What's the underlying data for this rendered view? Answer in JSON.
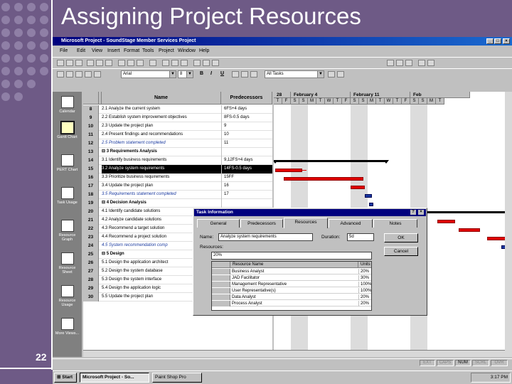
{
  "slide": {
    "title": "Assigning Project Resources",
    "number": "22"
  },
  "window": {
    "title": "Microsoft Project - SoundStage Member Services Project"
  },
  "menu": [
    "File",
    "Edit",
    "View",
    "Insert",
    "Format",
    "Tools",
    "Project",
    "Window",
    "Help"
  ],
  "toolbar": {
    "font": "Arial",
    "size": "8",
    "bold": "B",
    "italic": "I",
    "underline": "U",
    "filter": "All Tasks"
  },
  "views": [
    {
      "label": "Calendar",
      "icon": "calendar-icon"
    },
    {
      "label": "Gantt Chart",
      "icon": "gantt-chart-icon"
    },
    {
      "label": "PERT Chart",
      "icon": "pert-chart-icon"
    },
    {
      "label": "Task Usage",
      "icon": "task-usage-icon"
    },
    {
      "label": "Resource Graph",
      "icon": "resource-graph-icon"
    },
    {
      "label": "Resource Sheet",
      "icon": "resource-sheet-icon"
    },
    {
      "label": "Resource Usage",
      "icon": "resource-usage-icon"
    },
    {
      "label": "More Views...",
      "icon": "more-views-icon"
    }
  ],
  "table": {
    "headers": {
      "name": "Name",
      "predecessors": "Predecessors"
    },
    "rows": [
      {
        "id": "8",
        "name": "2.1 Analyze the current system",
        "pred": "6FS+4 days",
        "type": "task"
      },
      {
        "id": "9",
        "name": "2.2 Establish system improvement objectives",
        "pred": "8FS-0.5 days",
        "type": "task"
      },
      {
        "id": "10",
        "name": "2.3 Update the project plan",
        "pred": "9",
        "type": "task"
      },
      {
        "id": "11",
        "name": "2.4 Present findings and recommendations",
        "pred": "10",
        "type": "task"
      },
      {
        "id": "12",
        "name": "2.5 Problem statement completed",
        "pred": "11",
        "type": "milestone"
      },
      {
        "id": "13",
        "name": "⊟ 3 Requirements Analysis",
        "pred": "",
        "type": "summary"
      },
      {
        "id": "14",
        "name": "3.1 Identify business requirements",
        "pred": "9,12FS+4 days",
        "type": "task"
      },
      {
        "id": "15",
        "name": "3.2 Analyze system requirements",
        "pred": "14FS-0.5 days",
        "type": "selected"
      },
      {
        "id": "16",
        "name": "3.3 Prioritize business requirements",
        "pred": "15FF",
        "type": "task"
      },
      {
        "id": "17",
        "name": "3.4 Update the project plan",
        "pred": "16",
        "type": "task"
      },
      {
        "id": "18",
        "name": "3.5 Requirements statement completed",
        "pred": "17",
        "type": "milestone"
      },
      {
        "id": "19",
        "name": "⊟ 4 Decision Analysis",
        "pred": "",
        "type": "summary"
      },
      {
        "id": "20",
        "name": "4.1 Identify candidate solutions",
        "pred": "",
        "type": "task"
      },
      {
        "id": "21",
        "name": "4.2 Analyze candidate solutions",
        "pred": "",
        "type": "task"
      },
      {
        "id": "22",
        "name": "4.3 Recommend a target solution",
        "pred": "",
        "type": "task"
      },
      {
        "id": "23",
        "name": "4.4 Recommend a project solution",
        "pred": "",
        "type": "task"
      },
      {
        "id": "24",
        "name": "4.5 System recommendation comp",
        "pred": "",
        "type": "milestone"
      },
      {
        "id": "25",
        "name": "⊟ 5 Design",
        "pred": "",
        "type": "summary"
      },
      {
        "id": "26",
        "name": "5.1 Design the application architect",
        "pred": "",
        "type": "task"
      },
      {
        "id": "27",
        "name": "5.2 Design the system database",
        "pred": "",
        "type": "task"
      },
      {
        "id": "28",
        "name": "5.3 Design the system interface",
        "pred": "",
        "type": "task"
      },
      {
        "id": "29",
        "name": "5.4 Design the application logic",
        "pred": "",
        "type": "task"
      },
      {
        "id": "30",
        "name": "5.5 Update the project plan",
        "pred": "",
        "type": "task"
      }
    ]
  },
  "gantt": {
    "weeks": [
      "28",
      "February 4",
      "February 11",
      "Feb"
    ],
    "days": [
      "T",
      "F",
      "S",
      "S",
      "M",
      "T",
      "W",
      "T",
      "F",
      "S",
      "S",
      "M",
      "T",
      "W",
      "T",
      "F",
      "S",
      "S",
      "M",
      "T"
    ]
  },
  "dialog": {
    "title": "Task Information",
    "tabs": [
      "General",
      "Predecessors",
      "Resources",
      "Advanced",
      "Notes"
    ],
    "active_tab": "Resources",
    "name_label": "Name:",
    "name_value": "Analyze system requirements",
    "duration_label": "Duration:",
    "duration_value": "5d",
    "resources_label": "Resources:",
    "edit_value": "20%",
    "ok": "OK",
    "cancel": "Cancel",
    "columns": {
      "name": "Resource Name",
      "units": "Units"
    },
    "resources": [
      {
        "name": "Business Analyst",
        "units": "20%"
      },
      {
        "name": "JAD Facilitator",
        "units": "30%"
      },
      {
        "name": "Management Representative",
        "units": "100%"
      },
      {
        "name": "User Representative(s)",
        "units": "100%"
      },
      {
        "name": "Data Analyst",
        "units": "20%"
      },
      {
        "name": "Process Analyst",
        "units": "20%"
      }
    ]
  },
  "status": [
    "EXT",
    "CAPS",
    "NUM",
    "SCRL",
    "OVR"
  ],
  "taskbar": {
    "start": "Start",
    "apps": [
      "Microsoft Project - So...",
      "Paint Shop Pro"
    ],
    "clock": "3:17 PM"
  }
}
